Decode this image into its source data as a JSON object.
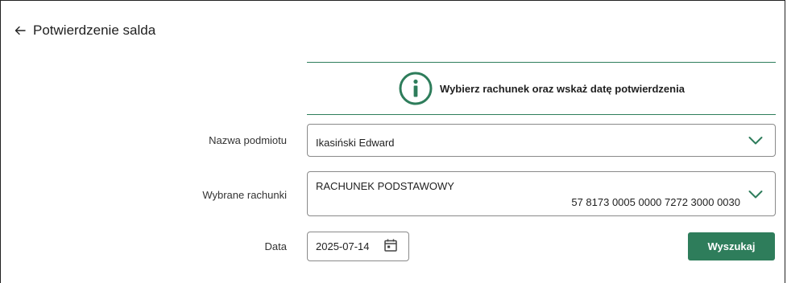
{
  "header": {
    "title": "Potwierdzenie salda",
    "back_icon": "arrow-left-icon"
  },
  "info": {
    "icon": "info-icon",
    "message": "Wybierz rachunek oraz wskaż datę potwierdzenia"
  },
  "form": {
    "entity": {
      "label": "Nazwa podmiotu",
      "value": "Ikasiński Edward"
    },
    "accounts": {
      "label": "Wybrane rachunki",
      "account_type": "RACHUNEK PODSTAWOWY",
      "account_number": "57 8173 0005 0000 7272 3000 0030"
    },
    "date": {
      "label": "Data",
      "value": "2025-07-14",
      "icon": "calendar-icon"
    },
    "search_label": "Wyszukaj"
  },
  "colors": {
    "accent": "#2e7d5b",
    "border": "#8a8a8a",
    "text": "#1f1f1f"
  }
}
